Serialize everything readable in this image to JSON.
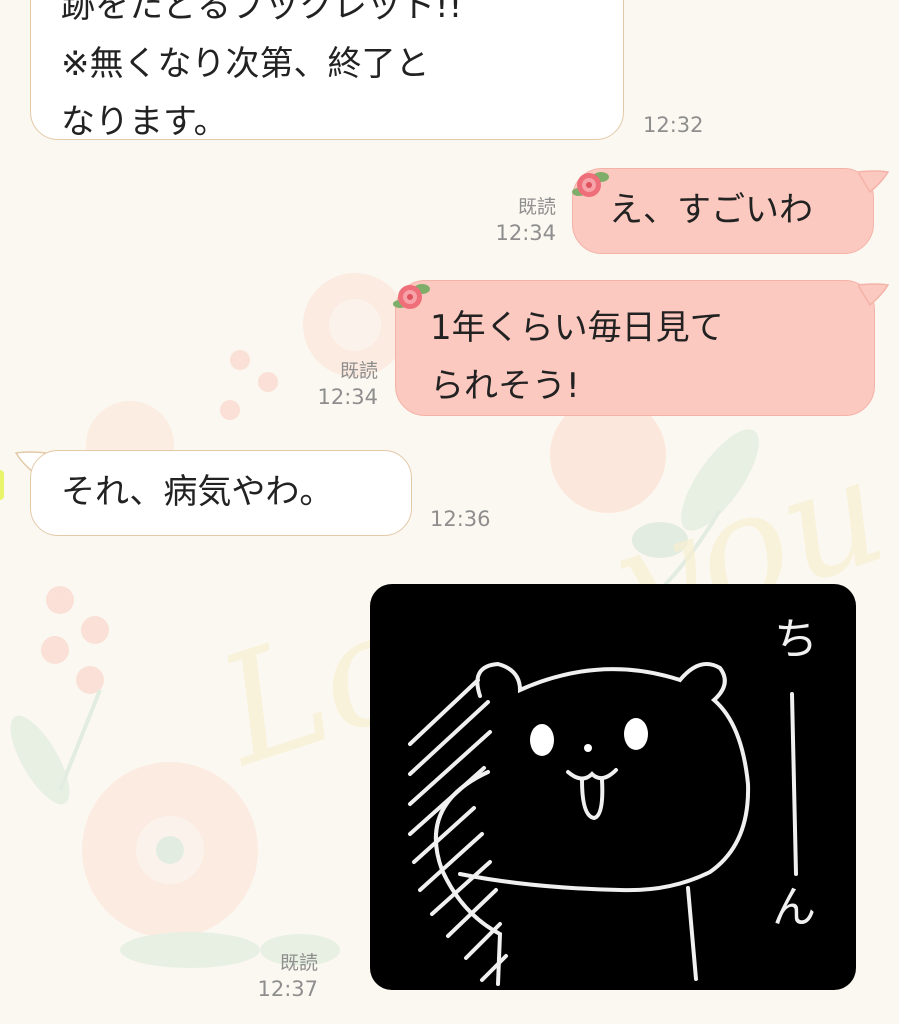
{
  "messages": [
    {
      "id": "m1",
      "side": "incoming",
      "lines": [
        "跡をたどるブックレット!!",
        "※無くなり次第、終了と",
        "なります。"
      ],
      "time": "12:32"
    },
    {
      "id": "m2",
      "side": "outgoing",
      "lines": [
        "え、すごいわ"
      ],
      "read": "既読",
      "time": "12:34"
    },
    {
      "id": "m3",
      "side": "outgoing",
      "lines": [
        "1年くらい毎日見て",
        "られそう!"
      ],
      "read": "既読",
      "time": "12:34"
    },
    {
      "id": "m4",
      "side": "incoming",
      "lines": [
        "それ、病気やわ。"
      ],
      "time": "12:36"
    },
    {
      "id": "m5",
      "side": "outgoing",
      "type": "sticker",
      "sticker_text": "ちーん",
      "read": "既読",
      "time": "12:37"
    }
  ],
  "background": {
    "watermark_text": "Love you"
  },
  "colors": {
    "outgoing_bubble": "#fcc9c0",
    "incoming_bubble": "#ffffff",
    "sticker_bg": "#000000"
  },
  "icons": {
    "rose": "rose-sticker-icon",
    "tail": "bubble-tail"
  }
}
